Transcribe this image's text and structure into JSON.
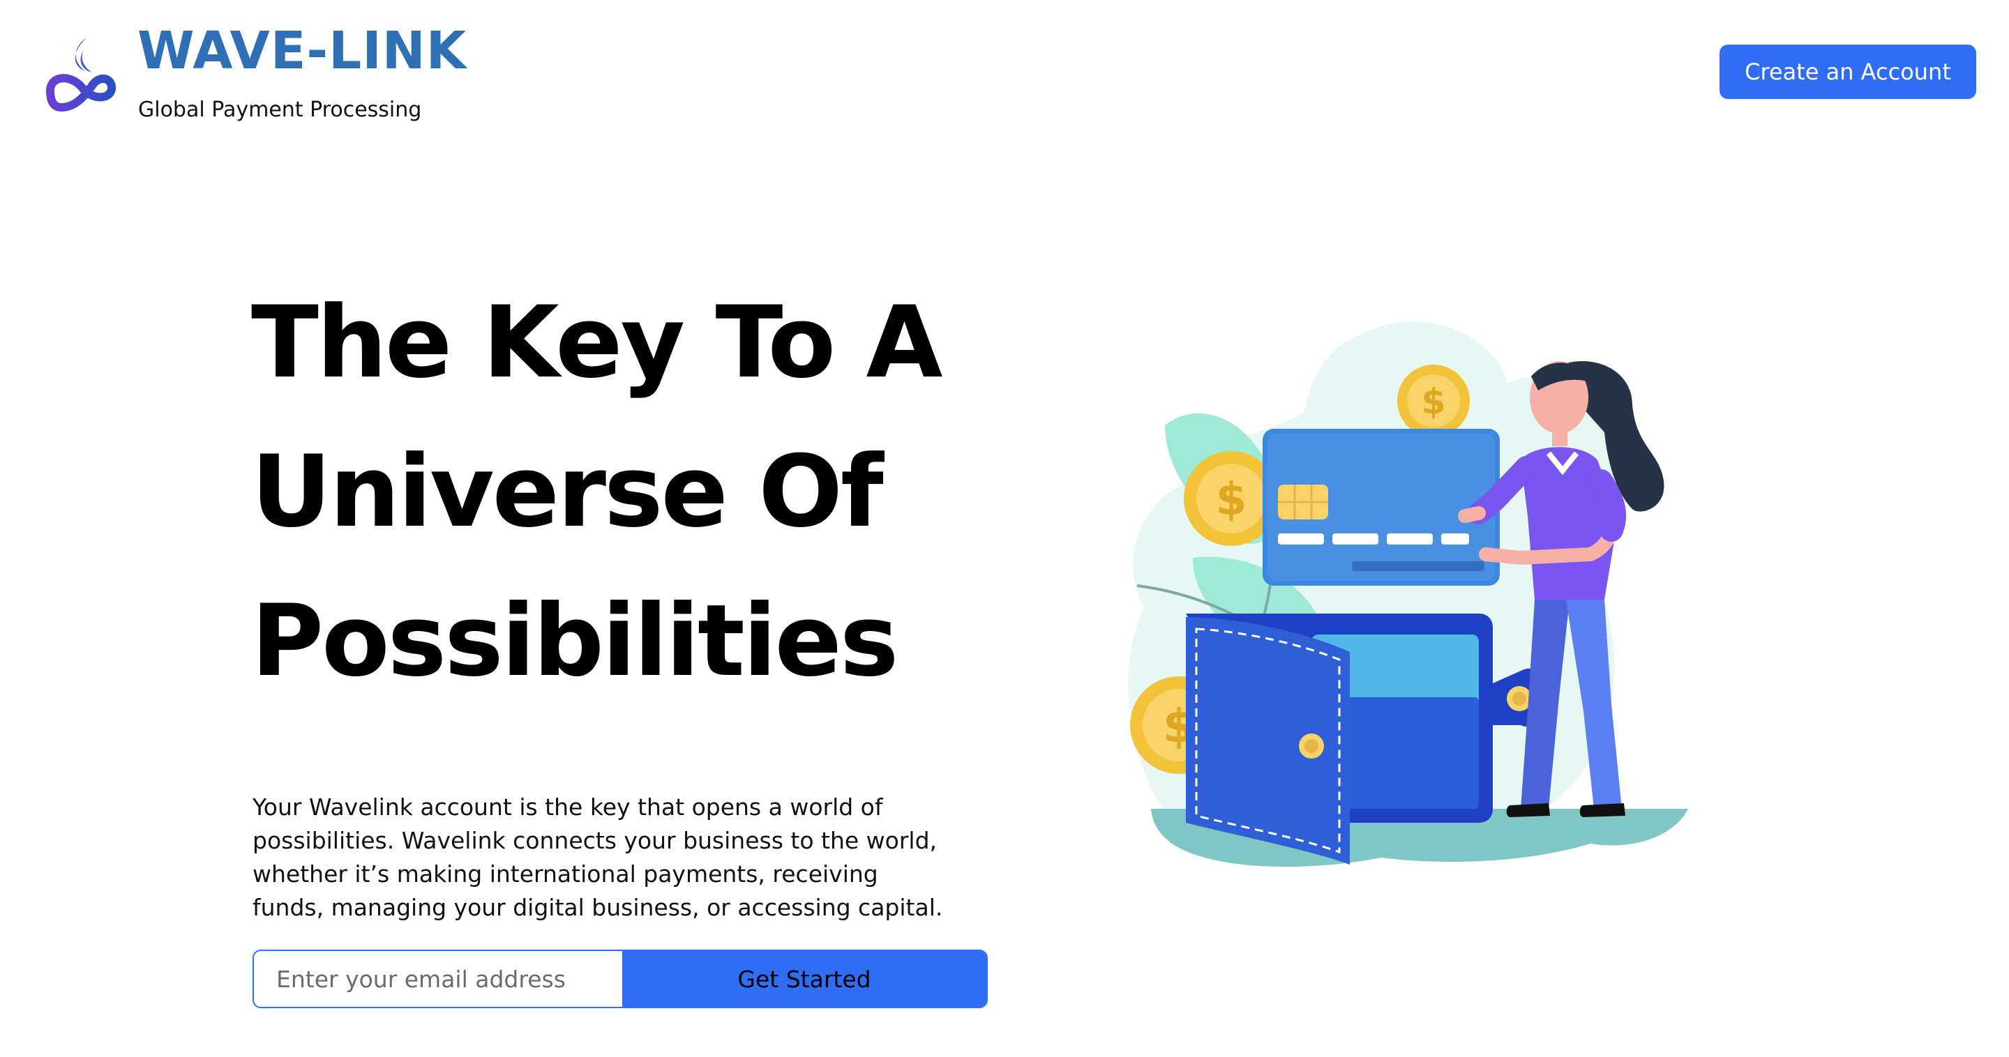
{
  "header": {
    "brand_name": "WAVE-LINK",
    "tagline": "Global Payment Processing",
    "create_account_label": "Create an Account"
  },
  "hero": {
    "title_lines": [
      "The Key To A",
      "Universe Of",
      "Possibilities"
    ],
    "description": "Your Wavelink account is the key that opens a world of possibilities. Wavelink connects your business to the world, whether it’s making international payments, receiving funds, managing your digital business, or accessing capital.",
    "email_placeholder": "Enter your email address",
    "get_started_label": "Get Started"
  },
  "colors": {
    "brand": "#2f6fb6",
    "accent": "#2f6ef4",
    "text": "#000000"
  },
  "icons": {
    "logo": "wave-link-logo-icon",
    "illustration": "wallet-credit-card-illustration"
  }
}
